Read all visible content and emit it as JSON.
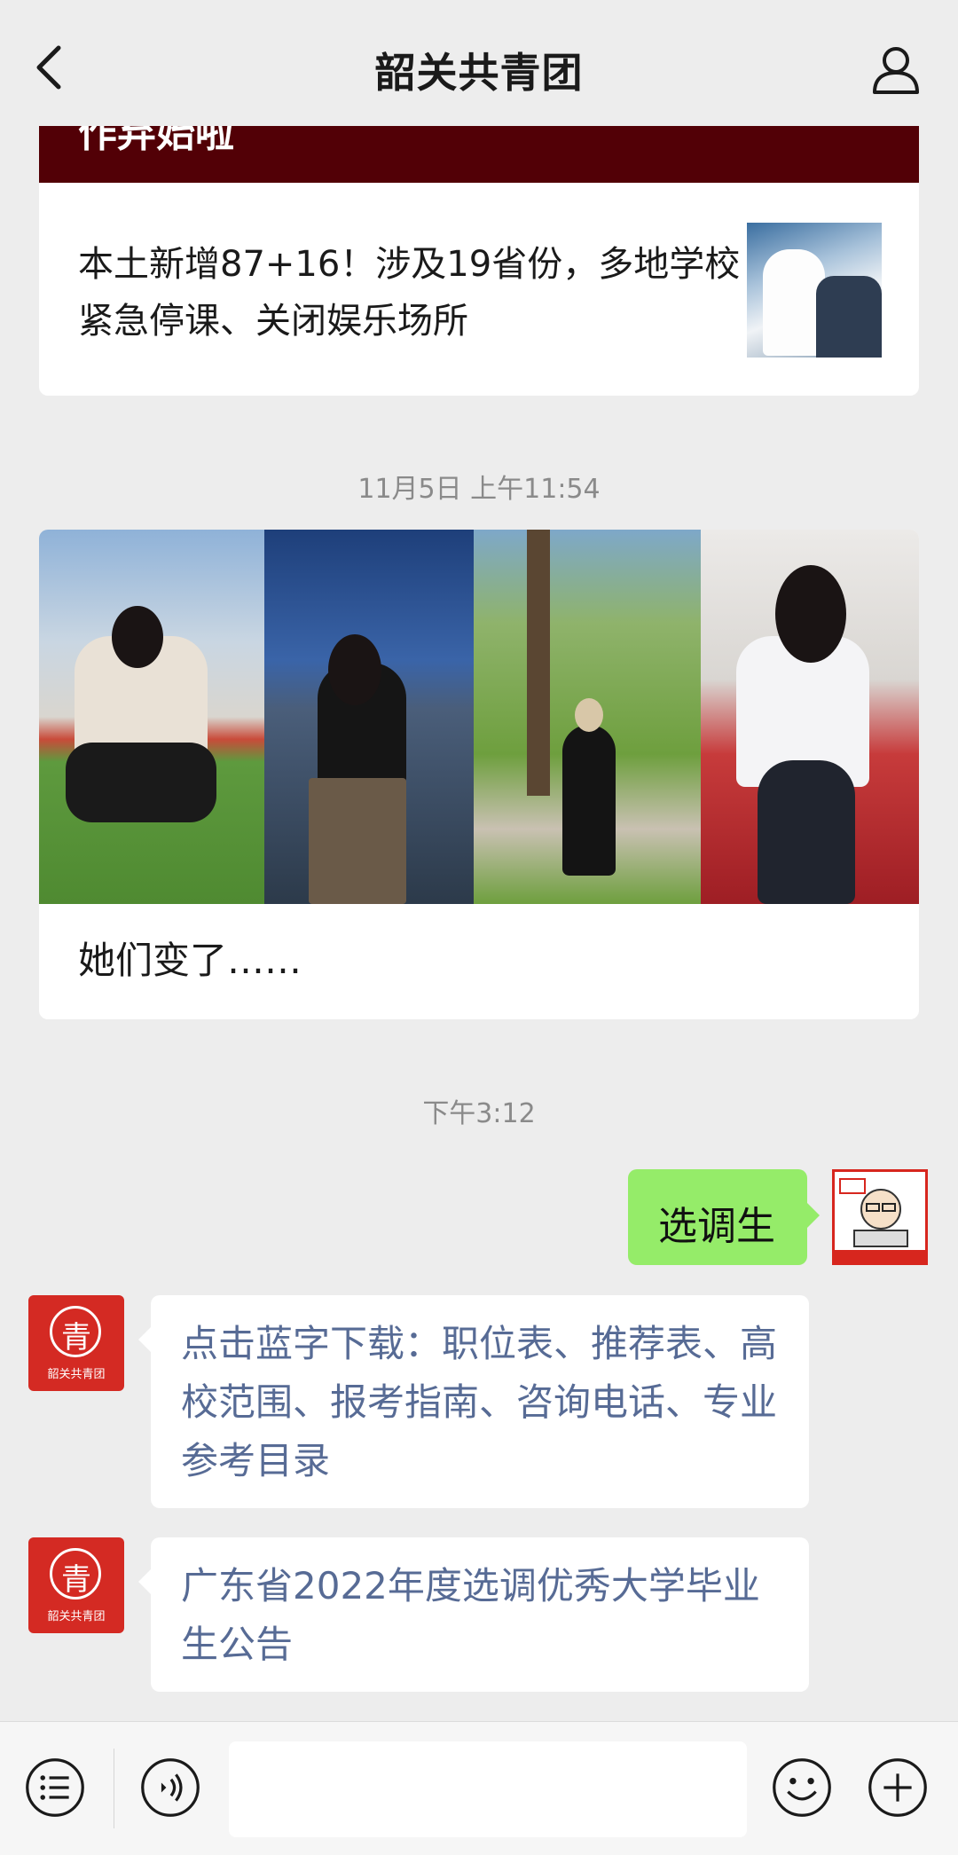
{
  "header": {
    "title": "韶关共青团",
    "back_icon": "chevron-left-icon",
    "profile_icon": "person-icon"
  },
  "messages": {
    "article1": {
      "banner_text": "作弃始啦",
      "title": "本土新增87+16！涉及19省份，多地学校紧急停课、关闭娱乐场所"
    },
    "time1": "11月5日 上午11:54",
    "article2": {
      "caption": "她们变了……"
    },
    "time2": "下午3:12",
    "user_message": "选调生",
    "bot_avatar_label": "韶关共青团",
    "bot_avatar_glyph": "青",
    "bot_reply1": "点击蓝字下载：职位表、推荐表、高校范围、报考指南、咨询电话、专业参考目录",
    "bot_reply2": "广东省2022年度选调优秀大学毕业生公告"
  },
  "bottom_bar": {
    "menu_icon": "menu-list-icon",
    "voice_icon": "voice-icon",
    "emoji_icon": "emoji-icon",
    "plus_icon": "plus-icon",
    "input_value": ""
  },
  "colors": {
    "background": "#ededed",
    "user_bubble": "#95ec69",
    "link_text": "#576b95",
    "brand_red": "#d42a23"
  }
}
